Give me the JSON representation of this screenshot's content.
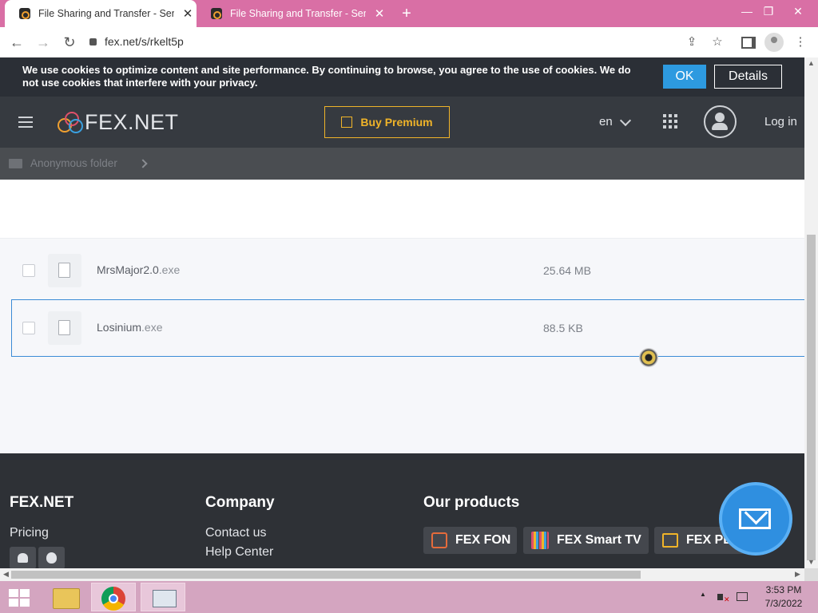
{
  "browser": {
    "tabs": [
      {
        "title": "File Sharing and Transfer - Send l",
        "active": true
      },
      {
        "title": "File Sharing and Transfer - Send l",
        "active": false
      }
    ],
    "new_tab": "+",
    "window_controls": {
      "minimize": "—",
      "restore": "❐",
      "close": "✕"
    },
    "nav": {
      "back": "←",
      "forward": "→",
      "reload": "↻"
    },
    "url": "fex.net/s/rkelt5p",
    "icons": {
      "share": "⇪",
      "star": "☆",
      "more": "⋮"
    }
  },
  "cookie_banner": {
    "text": "We use cookies to optimize content and site performance. By continuing to browse, you agree to the use of cookies. We do not use cookies that interfere with your privacy.",
    "ok_label": "OK",
    "details_label": "Details"
  },
  "header": {
    "logo_text": "FEX.NET",
    "buy_premium": "Buy Premium",
    "language": "en",
    "login": "Log in"
  },
  "breadcrumb": {
    "folder": "Anonymous folder"
  },
  "files": [
    {
      "name": "MrsMajor2.0",
      "ext": ".exe",
      "size": "25.64 MB",
      "selected": false
    },
    {
      "name": "Losinium",
      "ext": ".exe",
      "size": "88.5 KB",
      "selected": true
    }
  ],
  "footer": {
    "brand": {
      "title": "FEX.NET",
      "links": [
        "Pricing"
      ]
    },
    "company": {
      "title": "Company",
      "links": [
        "Contact us",
        "Help Center"
      ]
    },
    "products": {
      "title": "Our products",
      "items": [
        "FEX FON",
        "FEX Smart TV",
        "FEX PLUS"
      ]
    }
  },
  "taskbar": {
    "time": "3:53 PM",
    "date": "7/3/2022"
  },
  "colors": {
    "tabstrip": "#d96fa5",
    "header": "#363a40",
    "accent_yellow": "#f0b429",
    "accent_blue": "#2d9ae0",
    "footer": "#2e3136",
    "taskbar": "#d4a5c0"
  }
}
